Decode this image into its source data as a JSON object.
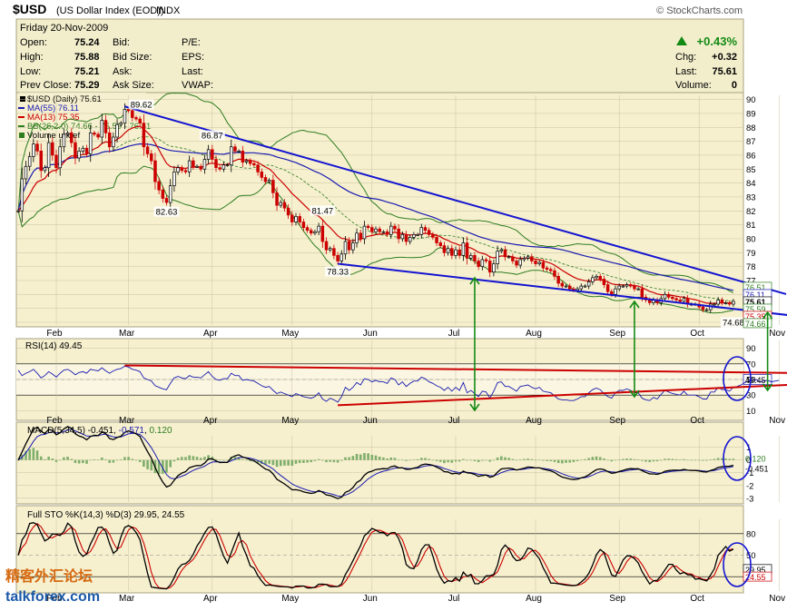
{
  "header": {
    "symbol": "$USD",
    "name": "(US Dollar Index (EOD))",
    "exchange": "INDX",
    "brand": "© StockCharts.com"
  },
  "quote": {
    "date_line": "Friday   20-Nov-2009",
    "labels": {
      "open": "Open:",
      "high": "High:",
      "low": "Low:",
      "prev_close": "Prev Close:",
      "bid": "Bid:",
      "bid_size": "Bid Size:",
      "ask": "Ask:",
      "ask_size": "Ask Size:",
      "pe": "P/E:",
      "eps": "EPS:",
      "last": "Last:",
      "vwap": "VWAP:",
      "chg": "Chg:",
      "last2": "Last:",
      "volume": "Volume:"
    },
    "values": {
      "open": "75.24",
      "high": "75.88",
      "low": "75.21",
      "prev_close": "75.29",
      "pct_change": "+0.43%",
      "chg": "+0.32",
      "last": "75.61",
      "volume": "0"
    }
  },
  "colors": {
    "price_up": "#000000",
    "price_down": "#cc0000",
    "ma55": "#1a1ab0",
    "ma13": "#cc0000",
    "bb": "#2e7d1f",
    "trendline": "#1414d0",
    "arrow": "#138a13",
    "circle": "#1414d0",
    "panel_bg": "#f6f0cf",
    "quote_bg": "#f2eecc",
    "grid": "#c9c2a0"
  },
  "chart_data": [
    {
      "type": "line",
      "title": "$USD (Daily) 75.61",
      "legend": [
        {
          "name": "$USD (Daily) 75.61",
          "color": "#000000"
        },
        {
          "name": "MA(55) 76.11",
          "color": "#1a1ab0"
        },
        {
          "name": "MA(13) 75.35",
          "color": "#cc0000"
        },
        {
          "name": "BB(26,2.0) 74.66 - 75.59 - 76.51",
          "color": "#2e7d1f"
        },
        {
          "name": "Volume undef",
          "color": "#2e7d1f"
        }
      ],
      "x_tick_labels": [
        "Feb",
        "Mar",
        "Apr",
        "May",
        "Jun",
        "Jul",
        "Aug",
        "Sep",
        "Oct",
        "Nov"
      ],
      "x_tick_index": [
        10,
        29,
        51,
        72,
        93,
        115,
        136,
        158,
        179,
        200
      ],
      "y_ticks": [
        74,
        75,
        76,
        77,
        78,
        79,
        80,
        81,
        82,
        83,
        84,
        85,
        86,
        87,
        88,
        89,
        90
      ],
      "ylim": [
        73.8,
        90.3
      ],
      "price": [
        82,
        84.3,
        85.2,
        85.9,
        86.8,
        86.3,
        84.9,
        85.1,
        86.9,
        86.0,
        85.1,
        86.6,
        87.5,
        87.6,
        86.9,
        85.8,
        86.3,
        86.5,
        86.1,
        87.6,
        87.5,
        87.3,
        88.5,
        87.6,
        86.6,
        87.3,
        88.2,
        88.3,
        89.3,
        89.2,
        88.7,
        88.6,
        88.3,
        86.6,
        86.1,
        85.6,
        84.1,
        83.5,
        82.9,
        82.6,
        83.8,
        84.8,
        85.1,
        84.9,
        84.8,
        85.6,
        85.2,
        85.2,
        85.0,
        85.7,
        86.4,
        85.7,
        85.1,
        85.0,
        85.3,
        85.3,
        86.6,
        86.3,
        86.3,
        85.5,
        85.6,
        85.4,
        85.3,
        84.8,
        84.4,
        84.1,
        84.2,
        83.3,
        82.4,
        82.6,
        82.2,
        81.7,
        81.2,
        81.6,
        81.2,
        80.8,
        80.6,
        80.4,
        80.5,
        80.9,
        79.8,
        79.2,
        79.3,
        78.8,
        78.4,
        78.9,
        79.8,
        79.2,
        79.7,
        80.4,
        80.0,
        80.9,
        80.8,
        80.5,
        80.7,
        80.5,
        80.5,
        80.3,
        80.9,
        80.7,
        80.0,
        80.3,
        79.8,
        80.1,
        80.3,
        80.3,
        80.8,
        80.6,
        80.3,
        80.1,
        79.7,
        79.5,
        79.0,
        79.3,
        78.8,
        79.2,
        78.8,
        79.7,
        78.6,
        78.8,
        78.4,
        78.0,
        78.5,
        78.4,
        77.6,
        78.2,
        79.1,
        79.2,
        78.7,
        78.7,
        78.4,
        78.1,
        78.5,
        78.6,
        78.7,
        78.4,
        78.2,
        78.3,
        77.9,
        77.8,
        77.7,
        77.3,
        76.8,
        76.6,
        76.6,
        76.4,
        76.3,
        76.4,
        76.6,
        76.6,
        76.9,
        77.2,
        77.3,
        77.1,
        76.7,
        76.2,
        76.0,
        76.4,
        76.6,
        76.6,
        76.7,
        76.6,
        76.4,
        76.4,
        75.8,
        75.6,
        75.4,
        75.6,
        75.4,
        75.7,
        76.0,
        75.8,
        75.7,
        75.6,
        75.5,
        75.7,
        75.3,
        75.3,
        75.3,
        75.1,
        74.9,
        74.9,
        75.3,
        75.3,
        75.6,
        75.4,
        75.4,
        75.3,
        75.5
      ],
      "annotations": [
        {
          "label": "89.62",
          "i": 29,
          "v": 89.62,
          "pos": "right"
        },
        {
          "label": "86.87",
          "i": 51,
          "v": 86.87,
          "pos": "above"
        },
        {
          "label": "82.63",
          "i": 39,
          "v": 82.63,
          "pos": "below"
        },
        {
          "label": "81.47",
          "i": 80,
          "v": 81.47,
          "pos": "above"
        },
        {
          "label": "78.33",
          "i": 84,
          "v": 78.33,
          "pos": "below"
        },
        {
          "label": "74.68",
          "i": 188,
          "v": 74.68,
          "pos": "below"
        }
      ],
      "right_labels": [
        {
          "label": "76.51",
          "v": 76.51
        },
        {
          "label": "76.11",
          "v": 76.11
        },
        {
          "label": "75.61",
          "v": 75.61
        },
        {
          "label": "75.59",
          "v": 75.59
        },
        {
          "label": "75.35",
          "v": 75.35
        },
        {
          "label": "74.66",
          "v": 74.66
        }
      ],
      "trendlines": [
        {
          "from": [
            28,
            89.5
          ],
          "to": [
            206,
            75.7
          ]
        },
        {
          "from": [
            84,
            78.2
          ],
          "to": [
            206,
            74.4
          ]
        }
      ]
    },
    {
      "type": "line",
      "title": "RSI(14) 49.45",
      "y_ticks": [
        10,
        30,
        50,
        70,
        90
      ],
      "ylim": [
        0,
        100
      ],
      "series_name": "RSI(14) 49.45",
      "last_value_label": "49.45",
      "values": [
        62,
        55,
        58,
        60,
        63,
        58,
        52,
        55,
        60,
        57,
        53,
        58,
        62,
        63,
        60,
        56,
        59,
        60,
        58,
        63,
        62,
        61,
        65,
        61,
        58,
        61,
        63,
        64,
        67,
        66,
        63,
        62,
        60,
        52,
        50,
        48,
        42,
        40,
        38,
        37,
        45,
        52,
        54,
        52,
        51,
        55,
        53,
        53,
        52,
        56,
        60,
        54,
        50,
        49,
        51,
        51,
        58,
        55,
        55,
        49,
        50,
        49,
        48,
        45,
        42,
        40,
        41,
        36,
        32,
        34,
        32,
        30,
        28,
        32,
        30,
        28,
        27,
        26,
        28,
        33,
        25,
        22,
        26,
        24,
        21,
        28,
        40,
        36,
        40,
        46,
        43,
        51,
        50,
        47,
        49,
        47,
        47,
        45,
        52,
        50,
        43,
        47,
        41,
        45,
        48,
        48,
        53,
        51,
        47,
        45,
        42,
        40,
        36,
        40,
        35,
        40,
        36,
        46,
        33,
        36,
        32,
        28,
        35,
        34,
        26,
        35,
        46,
        47,
        41,
        41,
        38,
        35,
        41,
        42,
        43,
        40,
        38,
        40,
        35,
        34,
        33,
        29,
        25,
        24,
        24,
        23,
        23,
        25,
        28,
        28,
        33,
        37,
        39,
        37,
        32,
        28,
        26,
        33,
        36,
        36,
        38,
        36,
        33,
        33,
        26,
        24,
        23,
        27,
        25,
        31,
        36,
        34,
        32,
        31,
        30,
        35,
        30,
        30,
        30,
        28,
        25,
        25,
        34,
        34,
        40,
        37,
        37,
        35,
        40,
        41,
        43,
        46,
        48,
        49,
        50,
        47,
        48,
        49,
        47,
        48,
        49
      ],
      "resistance": {
        "from": [
          28,
          68
        ],
        "to": [
          206,
          58
        ]
      },
      "support": {
        "from": [
          84,
          17
        ],
        "to": [
          206,
          45
        ]
      }
    },
    {
      "type": "line",
      "title": "MACD(5,34,5) -0.451, -0.571, 0.120",
      "y_ticks": [
        -3,
        -2,
        -1,
        0,
        1
      ],
      "ylim": [
        -3.3,
        1.9
      ],
      "series": [
        {
          "name": "MACD(5,34,5) -0.451",
          "color": "#000000",
          "last": "-0.451"
        },
        {
          "name": "-0.571",
          "color": "#1a1ab0",
          "last": "-0.571"
        },
        {
          "name": "0.120",
          "color": "#2e7d1f",
          "last": "0.120"
        }
      ],
      "right_labels": [
        {
          "label": "0.120",
          "v": 0.12
        },
        {
          "label": "-0.451",
          "v": -0.451
        }
      ]
    },
    {
      "type": "line",
      "title": "Full STO %K(14,3) %D(3) 29.95, 24.55",
      "y_ticks": [
        20,
        50,
        80
      ],
      "ylim": [
        0,
        100
      ],
      "series": [
        {
          "name": "%K(14,3) 29.95",
          "color": "#000000"
        },
        {
          "name": "%D(3) 24.55",
          "color": "#cc0000"
        }
      ],
      "right_labels": [
        {
          "label": "29.95",
          "v": 29.95
        },
        {
          "label": "24.55",
          "v": 24.55
        }
      ]
    }
  ],
  "watermark": {
    "top": "精客外汇论坛",
    "bottom": "talkforex.com"
  }
}
